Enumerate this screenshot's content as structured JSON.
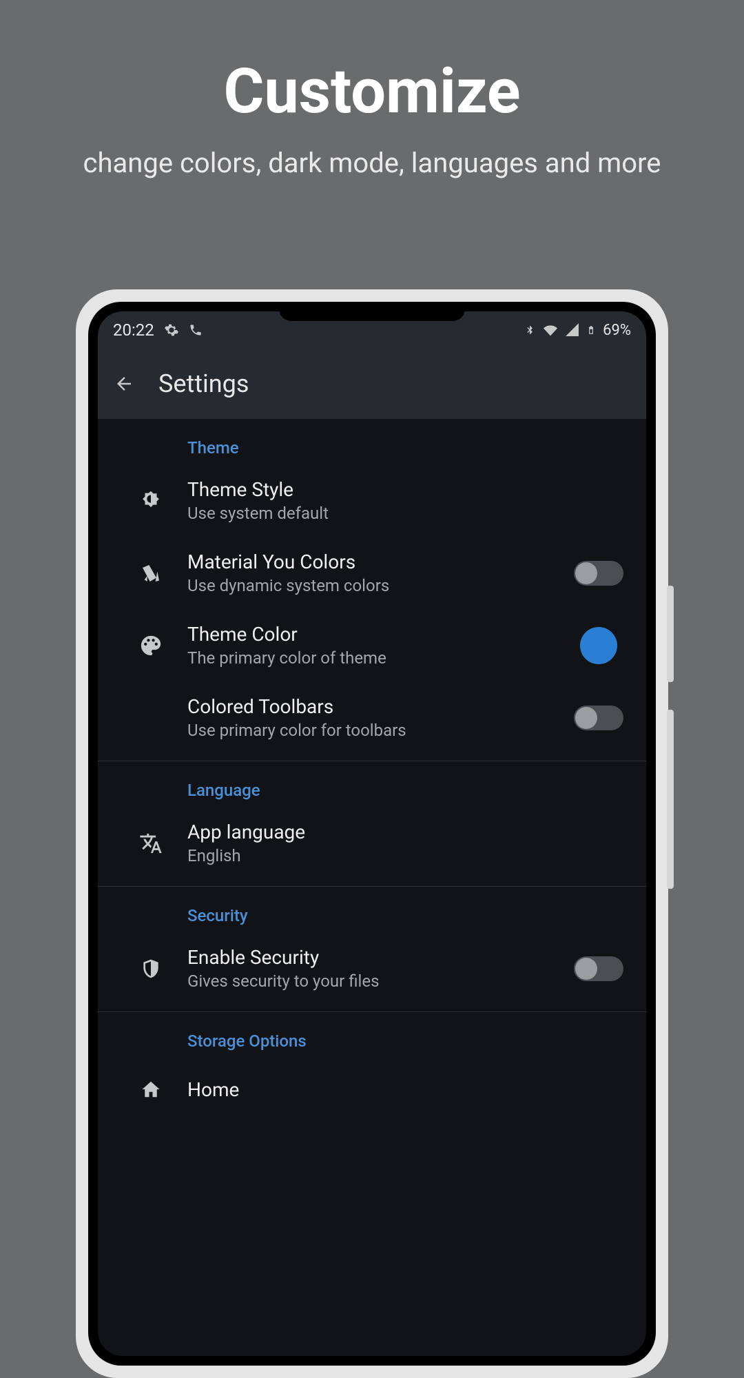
{
  "promo": {
    "title": "Customize",
    "subtitle": "change colors, dark mode, languages and more"
  },
  "statusbar": {
    "time": "20:22",
    "battery_text": "69%"
  },
  "appbar": {
    "title": "Settings"
  },
  "sections": {
    "theme": {
      "header": "Theme",
      "theme_style": {
        "title": "Theme Style",
        "sub": "Use system default"
      },
      "material_you": {
        "title": "Material You Colors",
        "sub": "Use dynamic system colors",
        "on": false
      },
      "theme_color": {
        "title": "Theme Color",
        "sub": "The primary color of theme",
        "color": "#2a7fd4"
      },
      "colored_toolbars": {
        "title": "Colored Toolbars",
        "sub": "Use primary color for toolbars",
        "on": false
      }
    },
    "language": {
      "header": "Language",
      "app_language": {
        "title": "App language",
        "sub": "English"
      }
    },
    "security": {
      "header": "Security",
      "enable_security": {
        "title": "Enable Security",
        "sub": "Gives security to your files",
        "on": false
      }
    },
    "storage": {
      "header": "Storage Options",
      "home": {
        "title": "Home"
      }
    }
  }
}
